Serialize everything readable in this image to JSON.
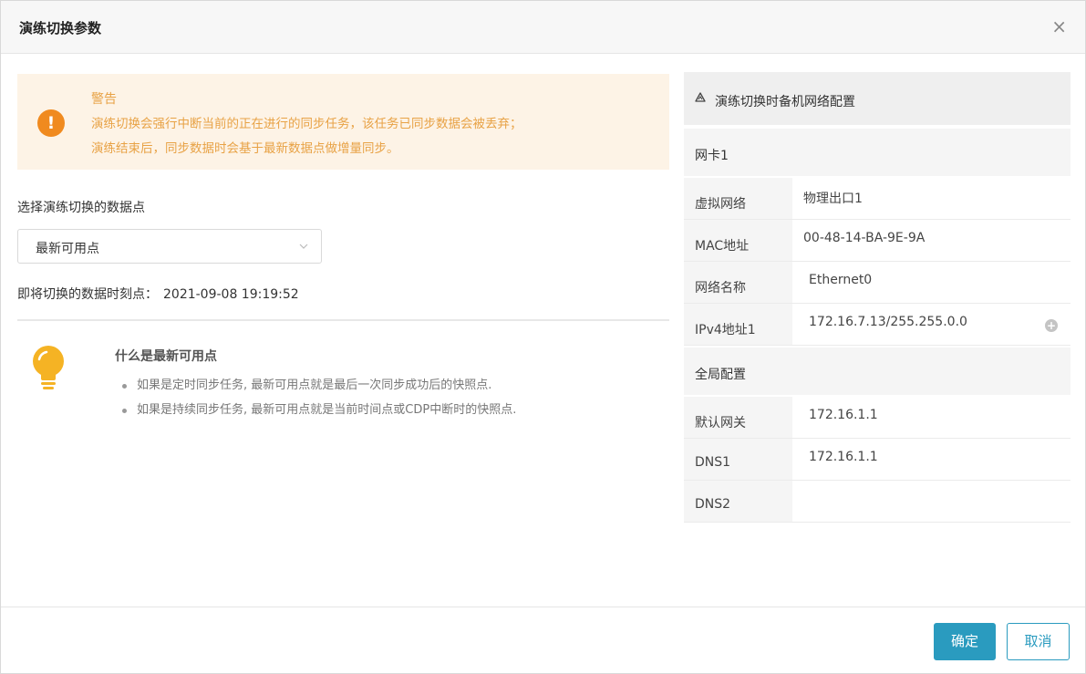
{
  "dialog": {
    "title": "演练切换参数",
    "close_glyph": "×"
  },
  "warning": {
    "icon": "exclamation-icon",
    "title": "警告",
    "line1": "演练切换会强行中断当前的正在进行的同步任务，该任务已同步数据会被丢弃；",
    "line2": "演练结束后，同步数据时会基于最新数据点做增量同步。",
    "color": "#e8a245",
    "background": "#fdf3e6"
  },
  "datapoint": {
    "label": "选择演练切换的数据点",
    "selected": "最新可用点",
    "timestamp_label": "即将切换的数据时刻点：",
    "timestamp_value": "2021-09-08 19:19:52"
  },
  "info": {
    "icon": "lightbulb-icon",
    "title": "什么是最新可用点",
    "items": [
      "如果是定时同步任务, 最新可用点就是最后一次同步成功后的快照点.",
      "如果是持续同步任务, 最新可用点就是当前时间点或CDP中断时的快照点."
    ]
  },
  "network": {
    "icon": "recycle-icon",
    "title": "演练切换时备机网络配置",
    "nic_section": "网卡1",
    "nic_rows": [
      {
        "key": "虚拟网络",
        "value": "物理出口1"
      },
      {
        "key": "MAC地址",
        "value": "00-48-14-BA-9E-9A"
      },
      {
        "key": "网络名称",
        "value": "Ethernet0"
      },
      {
        "key": "IPv4地址1",
        "value": "172.16.7.13/255.255.0.0"
      }
    ],
    "global_section": "全局配置",
    "global_rows": [
      {
        "key": "默认网关",
        "value": "172.16.1.1"
      },
      {
        "key": "DNS1",
        "value": "172.16.1.1"
      },
      {
        "key": "DNS2",
        "value": ""
      }
    ]
  },
  "footer": {
    "ok_label": "确定",
    "cancel_label": "取消",
    "accent": "#2a9bbf"
  }
}
